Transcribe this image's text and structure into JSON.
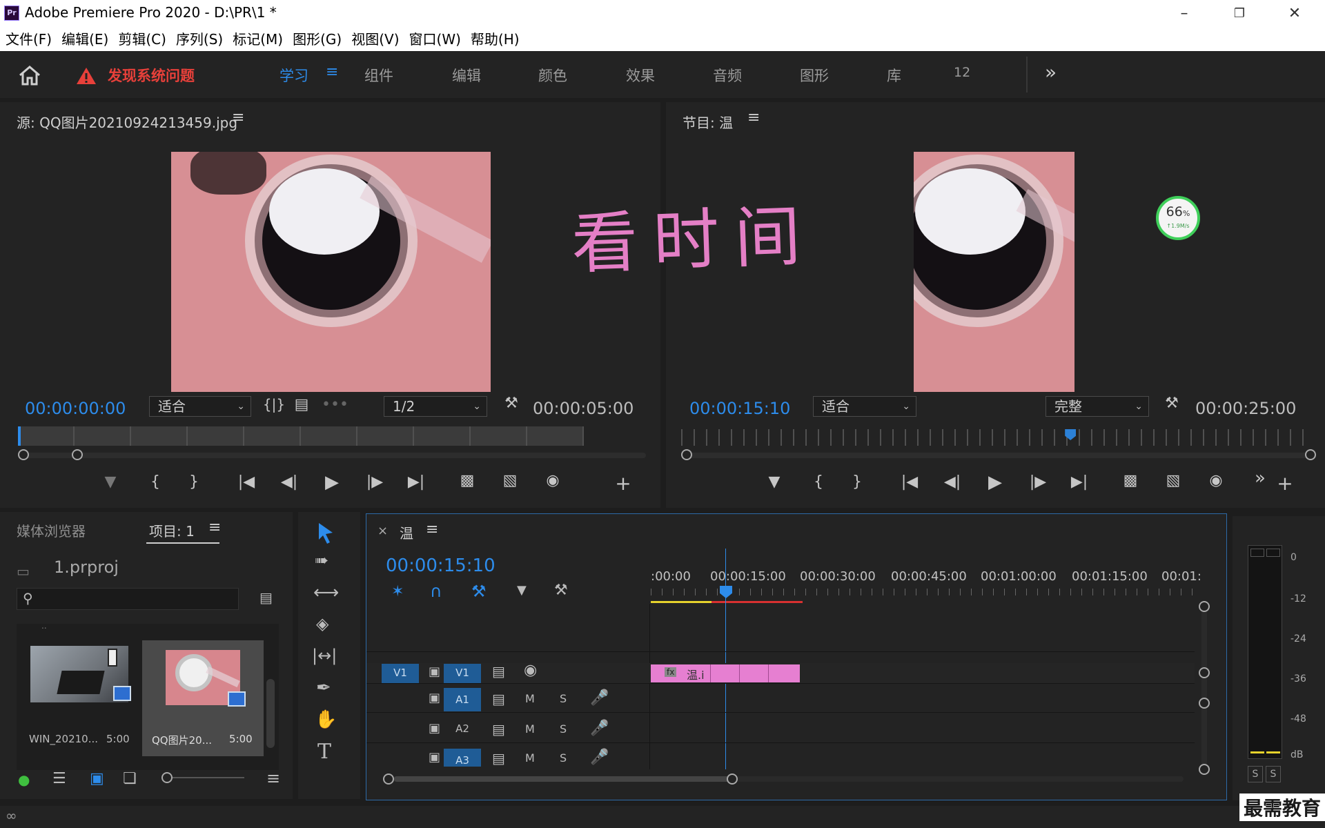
{
  "window": {
    "title": "Adobe Premiere Pro 2020 - D:\\PR\\1 *",
    "app_icon": "Pr"
  },
  "menu": [
    "文件(F)",
    "编辑(E)",
    "剪辑(C)",
    "序列(S)",
    "标记(M)",
    "图形(G)",
    "视图(V)",
    "窗口(W)",
    "帮助(H)"
  ],
  "workspace": {
    "warning": "发现系统问题",
    "tabs": [
      "学习",
      "组件",
      "编辑",
      "颜色",
      "效果",
      "音频",
      "图形",
      "库",
      "12"
    ],
    "active_tab": "学习"
  },
  "source": {
    "title": "源: QQ图片20210924213459.jpg",
    "timecode": "00:00:00:00",
    "fit": "适合",
    "resolution": "1/2",
    "duration": "00:00:05:00"
  },
  "overlay": {
    "text": "看时间",
    "color": "#e47fc6"
  },
  "program": {
    "title": "节目: 温",
    "timecode": "00:00:15:10",
    "fit": "适合",
    "quality": "完整",
    "duration": "00:00:25:00",
    "playhead_position": 0.62
  },
  "net_widget": {
    "percent": "66",
    "unit": "%",
    "speed": "↑1.9M/s"
  },
  "project": {
    "tab_media": "媒体浏览器",
    "tab_project": "项目: 1",
    "project_file": "1.prproj",
    "search_placeholder": "",
    "partial_label": "..",
    "items": [
      {
        "name": "WIN_20210...",
        "duration": "5:00"
      },
      {
        "name": "QQ图片20...",
        "duration": "5:00"
      }
    ]
  },
  "timeline": {
    "close": "×",
    "name": "温",
    "timecode": "00:00:15:10",
    "ruler": [
      ":00:00",
      "00:00:15:00",
      "00:00:30:00",
      "00:00:45:00",
      "00:01:00:00",
      "00:01:15:00",
      "00:01:"
    ],
    "source_patch": "V1",
    "tracks": [
      {
        "name": "V1",
        "type": "video"
      },
      {
        "name": "A1",
        "type": "audio",
        "mute": "M",
        "solo": "S"
      },
      {
        "name": "A2",
        "type": "audio",
        "mute": "M",
        "solo": "S"
      },
      {
        "name": "A3",
        "type": "audio",
        "mute": "M",
        "solo": "S"
      }
    ],
    "clip": {
      "fx": "fx",
      "label": "温.i",
      "color": "#e67fd1"
    }
  },
  "meter": {
    "labels": [
      "0",
      "-12",
      "-24",
      "-36",
      "-48",
      "dB"
    ],
    "solo": [
      "S",
      "S"
    ]
  },
  "watermark": "最需教育",
  "colors": {
    "accent": "#2d8ceb",
    "warning": "#e8403a",
    "bg": "#232323"
  }
}
